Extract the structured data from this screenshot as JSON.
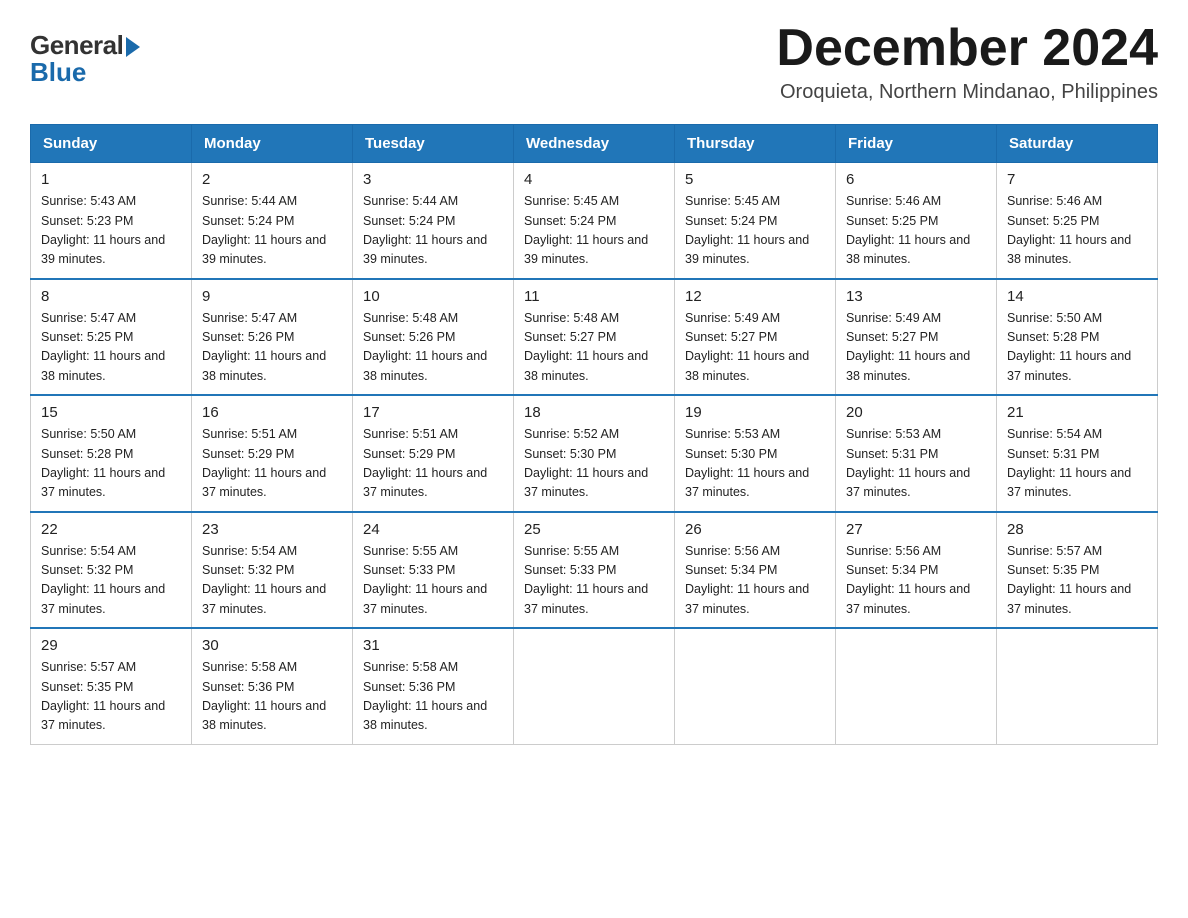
{
  "logo": {
    "general": "General",
    "blue": "Blue"
  },
  "header": {
    "month_year": "December 2024",
    "location": "Oroquieta, Northern Mindanao, Philippines"
  },
  "days_of_week": [
    "Sunday",
    "Monday",
    "Tuesday",
    "Wednesday",
    "Thursday",
    "Friday",
    "Saturday"
  ],
  "weeks": [
    [
      {
        "day": "1",
        "sunrise": "5:43 AM",
        "sunset": "5:23 PM",
        "daylight": "11 hours and 39 minutes."
      },
      {
        "day": "2",
        "sunrise": "5:44 AM",
        "sunset": "5:24 PM",
        "daylight": "11 hours and 39 minutes."
      },
      {
        "day": "3",
        "sunrise": "5:44 AM",
        "sunset": "5:24 PM",
        "daylight": "11 hours and 39 minutes."
      },
      {
        "day": "4",
        "sunrise": "5:45 AM",
        "sunset": "5:24 PM",
        "daylight": "11 hours and 39 minutes."
      },
      {
        "day": "5",
        "sunrise": "5:45 AM",
        "sunset": "5:24 PM",
        "daylight": "11 hours and 39 minutes."
      },
      {
        "day": "6",
        "sunrise": "5:46 AM",
        "sunset": "5:25 PM",
        "daylight": "11 hours and 38 minutes."
      },
      {
        "day": "7",
        "sunrise": "5:46 AM",
        "sunset": "5:25 PM",
        "daylight": "11 hours and 38 minutes."
      }
    ],
    [
      {
        "day": "8",
        "sunrise": "5:47 AM",
        "sunset": "5:25 PM",
        "daylight": "11 hours and 38 minutes."
      },
      {
        "day": "9",
        "sunrise": "5:47 AM",
        "sunset": "5:26 PM",
        "daylight": "11 hours and 38 minutes."
      },
      {
        "day": "10",
        "sunrise": "5:48 AM",
        "sunset": "5:26 PM",
        "daylight": "11 hours and 38 minutes."
      },
      {
        "day": "11",
        "sunrise": "5:48 AM",
        "sunset": "5:27 PM",
        "daylight": "11 hours and 38 minutes."
      },
      {
        "day": "12",
        "sunrise": "5:49 AM",
        "sunset": "5:27 PM",
        "daylight": "11 hours and 38 minutes."
      },
      {
        "day": "13",
        "sunrise": "5:49 AM",
        "sunset": "5:27 PM",
        "daylight": "11 hours and 38 minutes."
      },
      {
        "day": "14",
        "sunrise": "5:50 AM",
        "sunset": "5:28 PM",
        "daylight": "11 hours and 37 minutes."
      }
    ],
    [
      {
        "day": "15",
        "sunrise": "5:50 AM",
        "sunset": "5:28 PM",
        "daylight": "11 hours and 37 minutes."
      },
      {
        "day": "16",
        "sunrise": "5:51 AM",
        "sunset": "5:29 PM",
        "daylight": "11 hours and 37 minutes."
      },
      {
        "day": "17",
        "sunrise": "5:51 AM",
        "sunset": "5:29 PM",
        "daylight": "11 hours and 37 minutes."
      },
      {
        "day": "18",
        "sunrise": "5:52 AM",
        "sunset": "5:30 PM",
        "daylight": "11 hours and 37 minutes."
      },
      {
        "day": "19",
        "sunrise": "5:53 AM",
        "sunset": "5:30 PM",
        "daylight": "11 hours and 37 minutes."
      },
      {
        "day": "20",
        "sunrise": "5:53 AM",
        "sunset": "5:31 PM",
        "daylight": "11 hours and 37 minutes."
      },
      {
        "day": "21",
        "sunrise": "5:54 AM",
        "sunset": "5:31 PM",
        "daylight": "11 hours and 37 minutes."
      }
    ],
    [
      {
        "day": "22",
        "sunrise": "5:54 AM",
        "sunset": "5:32 PM",
        "daylight": "11 hours and 37 minutes."
      },
      {
        "day": "23",
        "sunrise": "5:54 AM",
        "sunset": "5:32 PM",
        "daylight": "11 hours and 37 minutes."
      },
      {
        "day": "24",
        "sunrise": "5:55 AM",
        "sunset": "5:33 PM",
        "daylight": "11 hours and 37 minutes."
      },
      {
        "day": "25",
        "sunrise": "5:55 AM",
        "sunset": "5:33 PM",
        "daylight": "11 hours and 37 minutes."
      },
      {
        "day": "26",
        "sunrise": "5:56 AM",
        "sunset": "5:34 PM",
        "daylight": "11 hours and 37 minutes."
      },
      {
        "day": "27",
        "sunrise": "5:56 AM",
        "sunset": "5:34 PM",
        "daylight": "11 hours and 37 minutes."
      },
      {
        "day": "28",
        "sunrise": "5:57 AM",
        "sunset": "5:35 PM",
        "daylight": "11 hours and 37 minutes."
      }
    ],
    [
      {
        "day": "29",
        "sunrise": "5:57 AM",
        "sunset": "5:35 PM",
        "daylight": "11 hours and 37 minutes."
      },
      {
        "day": "30",
        "sunrise": "5:58 AM",
        "sunset": "5:36 PM",
        "daylight": "11 hours and 38 minutes."
      },
      {
        "day": "31",
        "sunrise": "5:58 AM",
        "sunset": "5:36 PM",
        "daylight": "11 hours and 38 minutes."
      },
      null,
      null,
      null,
      null
    ]
  ]
}
